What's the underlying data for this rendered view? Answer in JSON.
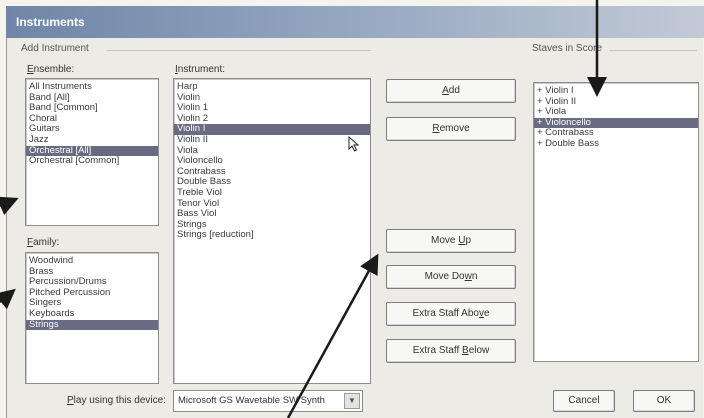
{
  "window": {
    "title": "Instruments"
  },
  "add_instrument": {
    "group_label": "Add Instrument",
    "ensemble": {
      "label_prefix": "",
      "label_mnemonic": "E",
      "label_rest": "nsemble:",
      "items": [
        "All Instruments",
        "Band [All]",
        "Band [Common]",
        "Choral",
        "Guitars",
        "Jazz",
        "Orchestral [All]",
        "Orchestral [Common]"
      ],
      "selected": "Orchestral [All]"
    },
    "family": {
      "label_prefix": "",
      "label_mnemonic": "F",
      "label_rest": "amily:",
      "items": [
        "Woodwind",
        "Brass",
        "Percussion/Drums",
        "Pitched Percussion",
        "Singers",
        "Keyboards",
        "Strings"
      ],
      "selected": "Strings"
    },
    "instrument": {
      "label_prefix": "",
      "label_mnemonic": "I",
      "label_rest": "nstrument:",
      "items": [
        "Harp",
        "Violin",
        "Violin 1",
        "Violin 2",
        "Violin I",
        "Violin II",
        "Viola",
        "Violoncello",
        "Contrabass",
        "Double Bass",
        "Treble Viol",
        "Tenor Viol",
        "Bass Viol",
        "Strings",
        "Strings [reduction]"
      ],
      "selected": "Violin I"
    }
  },
  "buttons": {
    "add": {
      "prefix": "",
      "mnemonic": "A",
      "rest": "dd"
    },
    "remove": {
      "prefix": "",
      "mnemonic": "R",
      "rest": "emove"
    },
    "move_up": {
      "prefix": "Move ",
      "mnemonic": "U",
      "rest": "p"
    },
    "move_down": {
      "prefix": "Move Do",
      "mnemonic": "w",
      "rest": "n"
    },
    "extra_above": {
      "prefix": "Extra Staff Abo",
      "mnemonic": "v",
      "rest": "e"
    },
    "extra_below": {
      "prefix": "Extra Staff ",
      "mnemonic": "B",
      "rest": "elow"
    },
    "cancel": "Cancel",
    "ok": "OK"
  },
  "staves": {
    "label": "Staves in Score",
    "items": [
      "+ Violin I",
      "+ Violin II",
      "+ Viola",
      "+ Violoncello",
      "+ Contrabass",
      "+ Double Bass"
    ],
    "selected": "+ Violoncello"
  },
  "device": {
    "label_prefix": "",
    "label_mnemonic": "P",
    "label_rest": "lay using this device:",
    "value": "Microsoft GS Wavetable SW Synth"
  },
  "icons": {
    "cursor": "mouse-pointer-icon",
    "dropdown": "chevron-down-icon"
  },
  "colors": {
    "selection": "#6a6a82",
    "titlebar": "#6f86a8"
  }
}
